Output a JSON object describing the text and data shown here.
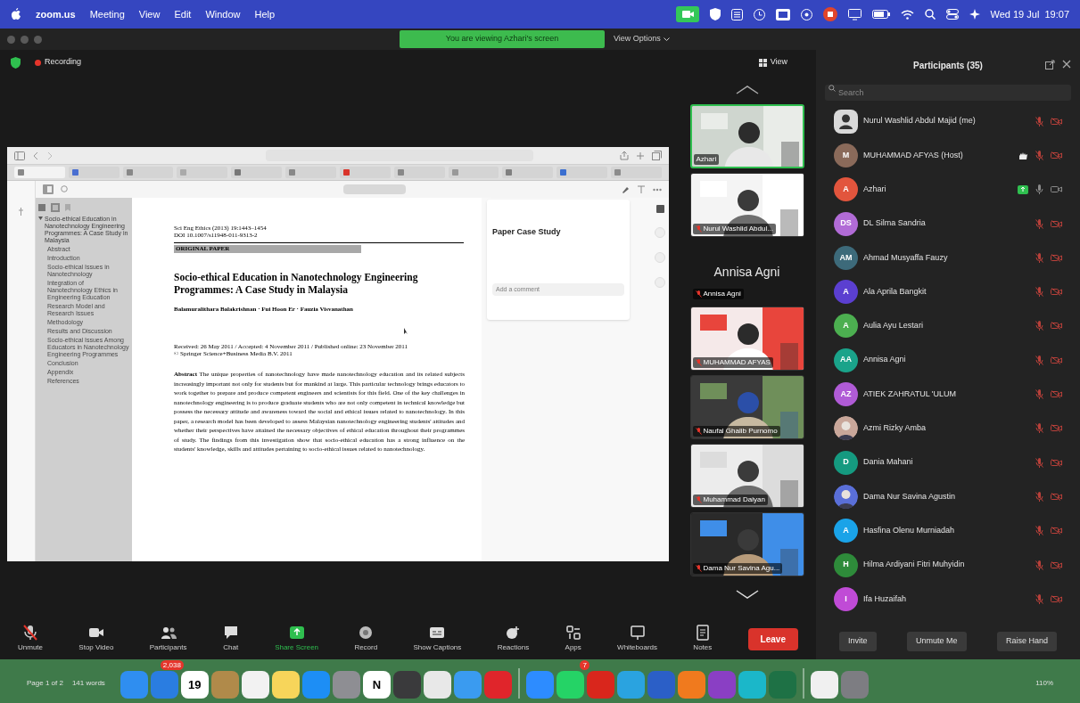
{
  "menu_bar": {
    "app": "zoom.us",
    "menus": [
      "Meeting",
      "View",
      "Edit",
      "Window",
      "Help"
    ],
    "clock": "Wed 19 Jul  19:07"
  },
  "banner": {
    "text": "You are viewing Azhari's screen",
    "options": "View Options"
  },
  "recording": {
    "label": "Recording",
    "on": true
  },
  "view_button": "View",
  "shared_window": {
    "outline": [
      {
        "title": "Socio-ethical Education in Nanotechnology Engineering Programmes: A Case Study in Malaysia",
        "children": [
          {
            "title": "Abstract"
          },
          {
            "title": "Introduction"
          },
          {
            "title": "Socio-ethical Issues in Nanotechnology"
          },
          {
            "title": "Integration of Nanotechnology Ethics in Engineering Education"
          },
          {
            "title": "Research Model and Research Issues"
          },
          {
            "title": "Methodology"
          },
          {
            "title": "Results and Discussion"
          },
          {
            "title": "Socio-ethical Issues Among Educators in Nanotechnology Engineering Programmes"
          },
          {
            "title": "Conclusion"
          },
          {
            "title": "Appendix"
          },
          {
            "title": "References"
          }
        ]
      }
    ],
    "paper": {
      "journal": "Sci Eng Ethics (2013) 19:1443–1454",
      "doi": "DOI 10.1007/s11948-011-9313-2",
      "section": "ORIGINAL PAPER",
      "title": "Socio-ethical Education in Nanotechnology Engineering Programmes: A Case Study in Malaysia",
      "authors": "Balamuralithara Balakrishnan · Fui Hoon Er · Fauzia Visvanathan",
      "received": "Received: 26 May 2011 / Accepted: 4 November 2011 / Published online: 23 November 2011",
      "copyright": "© Springer Science+Business Media B.V. 2011",
      "abstract": "**Abstract**  The unique properties of nanotechnology have made nanotechnology education and its related subjects increasingly important not only for students but for mankind at large. This particular technology brings educators to work together to prepare and produce competent engineers and scientists for this field. One of the key challenges in nanotechnology engineering is to produce graduate students who are not only competent in technical knowledge but possess the necessary attitude and awareness toward the social and ethical issues related to nanotechnology. In this paper, a research model has been developed to assess Malaysian nanotechnology engineering students' attitudes and whether their perspectives have attained the necessary objectives of ethical education throughout their programmes of study. The findings from this investigation show that socio-ethical education has a strong influence on the students' knowledge, skills and attitudes pertaining to socio-ethical issues related to nanotechnology."
    },
    "side_panel": {
      "heading": "Paper Case Study",
      "comment_placeholder": "Add a comment"
    },
    "browser_tabs": [
      {
        "selected": true,
        "color": "#888888"
      },
      {
        "selected": false,
        "color": "#4a6fd1"
      },
      {
        "selected": false,
        "color": "#888888"
      },
      {
        "selected": false,
        "color": "#aaaaaa"
      },
      {
        "selected": false,
        "color": "#777777"
      },
      {
        "selected": false,
        "color": "#888888"
      },
      {
        "selected": false,
        "color": "#d9342b"
      },
      {
        "selected": false,
        "color": "#888888"
      },
      {
        "selected": false,
        "color": "#999999"
      },
      {
        "selected": false,
        "color": "#808080"
      },
      {
        "selected": false,
        "color": "#3b6fd0"
      },
      {
        "selected": false,
        "color": "#8c8c8c"
      }
    ]
  },
  "video_tiles": [
    {
      "name": "Azhari",
      "kind": "video",
      "muted": false,
      "speaking": true
    },
    {
      "name": "Nurul Washlid Abdul...",
      "kind": "video",
      "muted": true,
      "speaking": false
    },
    {
      "name": "Annisa Agni",
      "caption": "Annisa Agni",
      "kind": "name_only",
      "muted": true,
      "speaking": false
    },
    {
      "name": "MUHAMMAD AFYAS",
      "kind": "video",
      "muted": true,
      "speaking": false
    },
    {
      "name": "Naufal Ghalib Purnomo",
      "kind": "video",
      "muted": true,
      "speaking": false
    },
    {
      "name": "Muhammad Daiyan",
      "kind": "video",
      "muted": true,
      "speaking": false
    },
    {
      "name": "Dama Nur Savina Agu...",
      "kind": "video",
      "muted": true,
      "speaking": false
    }
  ],
  "toolbar": [
    {
      "label": "Unmute",
      "kind": "mic",
      "muted": true
    },
    {
      "label": "Stop Video",
      "kind": "video"
    },
    {
      "label": "Participants",
      "kind": "participants"
    },
    {
      "label": "Chat",
      "kind": "chat"
    },
    {
      "label": "Share Screen",
      "kind": "share"
    },
    {
      "label": "Record",
      "kind": "record"
    },
    {
      "label": "Show Captions",
      "kind": "captions"
    },
    {
      "label": "Reactions",
      "kind": "reactions"
    },
    {
      "label": "Apps",
      "kind": "apps"
    },
    {
      "label": "Whiteboards",
      "kind": "whiteboard"
    },
    {
      "label": "Notes",
      "kind": "notes"
    },
    {
      "label": "Leave",
      "kind": "leave"
    }
  ],
  "participants": {
    "title": "Participants (35)",
    "search_placeholder": "Search",
    "items": [
      {
        "name": "Nurul Washlid Abdul Majid (me)",
        "kind": "silhouette",
        "color": "#d9d9d9",
        "muted": true,
        "video_on": false,
        "sharing": false,
        "hand_raised": false
      },
      {
        "name": "MUHAMMAD AFYAS (Host)",
        "kind": "initials",
        "initials": "M",
        "color": "#8a6a5a",
        "muted": true,
        "video_on": false,
        "sharing": false,
        "hand_raised": true
      },
      {
        "name": "Azhari",
        "kind": "initials",
        "initials": "A",
        "color": "#e2553d",
        "muted": false,
        "video_on": true,
        "sharing": true,
        "hand_raised": false
      },
      {
        "name": "DL Silma Sandria",
        "kind": "initials",
        "initials": "DS",
        "color": "#b16bd6",
        "muted": true,
        "video_on": false,
        "sharing": false,
        "hand_raised": false
      },
      {
        "name": "Ahmad Musyaffa Fauzy",
        "kind": "initials",
        "initials": "AM",
        "color": "#3d6a7a",
        "muted": true,
        "video_on": false,
        "sharing": false,
        "hand_raised": false
      },
      {
        "name": "Ala Aprila Bangkit",
        "kind": "initials",
        "initials": "A",
        "color": "#5b3fd0",
        "muted": true,
        "video_on": false,
        "sharing": false,
        "hand_raised": false
      },
      {
        "name": "Aulia Ayu Lestari",
        "kind": "initials",
        "initials": "A",
        "color": "#4caf50",
        "muted": true,
        "video_on": false,
        "sharing": false,
        "hand_raised": false
      },
      {
        "name": "Annisa Agni",
        "kind": "initials",
        "initials": "AA",
        "color": "#1aa38a",
        "muted": true,
        "video_on": false,
        "sharing": false,
        "hand_raised": false
      },
      {
        "name": "ATIEK ZAHRATUL 'ULUM",
        "kind": "initials",
        "initials": "AZ",
        "color": "#b05bd6",
        "muted": true,
        "video_on": false,
        "sharing": false,
        "hand_raised": false
      },
      {
        "name": "Azmi Rizky Amba",
        "color": "#c9a79a",
        "muted": true,
        "video_on": false,
        "sharing": false,
        "hand_raised": false
      },
      {
        "name": "Dania Mahani",
        "kind": "initials",
        "initials": "D",
        "color": "#159a80",
        "muted": true,
        "video_on": false,
        "sharing": false,
        "hand_raised": false
      },
      {
        "name": "Dama Nur Savina Agustin",
        "color": "#5a6fd8",
        "muted": true,
        "video_on": false,
        "sharing": false,
        "hand_raised": false
      },
      {
        "name": "Hasfina Olenu Murniadah",
        "kind": "initials",
        "initials": "A",
        "color": "#1aa3e8",
        "muted": true,
        "video_on": false,
        "sharing": false,
        "hand_raised": false
      },
      {
        "name": "Hilma Ardiyani Fitri Muhyidin",
        "kind": "initials",
        "initials": "H",
        "color": "#2e8b3a",
        "muted": true,
        "video_on": false,
        "sharing": false,
        "hand_raised": false
      },
      {
        "name": "Ifa Huzaifah",
        "kind": "initials",
        "initials": "I",
        "color": "#c04bd6",
        "muted": true,
        "video_on": false,
        "sharing": false,
        "hand_raised": false
      }
    ],
    "buttons": [
      "Invite",
      "Unmute Me",
      "Raise Hand"
    ]
  },
  "dock": {
    "status_left": [
      "Page 1 of 2",
      "141 words"
    ],
    "zoom_level": "110%",
    "apps": [
      {
        "color": "#2f8ef0"
      },
      {
        "color": "#2a7de1",
        "badge": "2,038"
      },
      {
        "color": "#ffffff",
        "glyph": "19"
      },
      {
        "color": "#b08a4a"
      },
      {
        "color": "#f2f2f2"
      },
      {
        "color": "#f7d55a"
      },
      {
        "color": "#1d8ef5"
      },
      {
        "color": "#8e8e93"
      },
      {
        "color": "#ffffff",
        "glyph": "N"
      },
      {
        "color": "#3a3a3c"
      },
      {
        "color": "#e8e8e8"
      },
      {
        "color": "#3a9bf0"
      },
      {
        "color": "#e0252b"
      },
      {
        "color": "#2d8cff",
        "divider": true
      },
      {
        "color": "#25d366",
        "badge": "7"
      },
      {
        "color": "#d9261c"
      },
      {
        "color": "#2aa3e0"
      },
      {
        "color": "#2b5fc7"
      },
      {
        "color": "#f07a1e"
      },
      {
        "color": "#8a3fc4"
      },
      {
        "color": "#1bb7c9"
      },
      {
        "color": "#1e7145"
      },
      {
        "color": "#f0f0f0",
        "divider": true
      },
      {
        "color": "#7d7d82"
      }
    ]
  }
}
